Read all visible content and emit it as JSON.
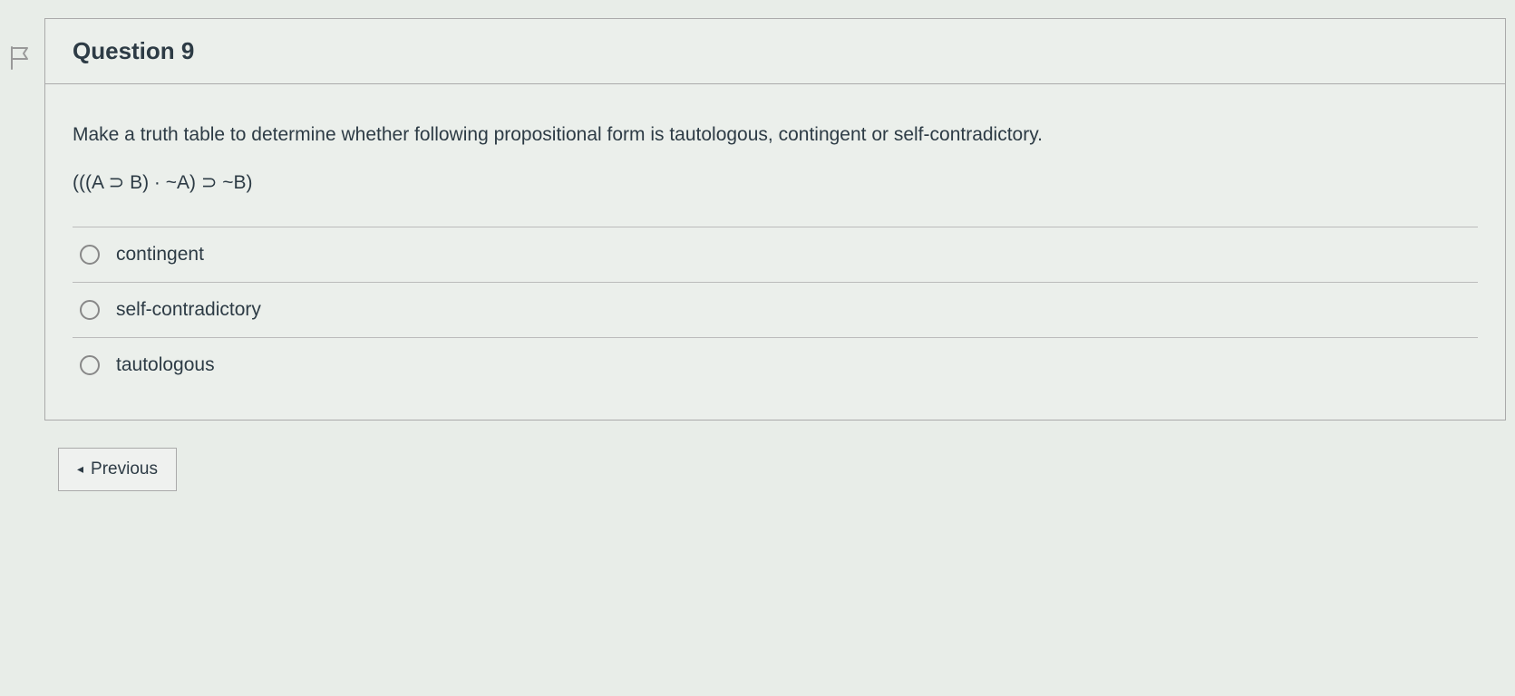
{
  "question": {
    "title": "Question 9",
    "prompt": "Make a truth table to determine whether following propositional form is tautologous, contingent or self-contradictory.",
    "formula": "(((A ⊃ B) · ~A) ⊃ ~B)",
    "options": [
      {
        "label": "contingent"
      },
      {
        "label": "self-contradictory"
      },
      {
        "label": "tautologous"
      }
    ]
  },
  "nav": {
    "previous_label": "Previous"
  }
}
